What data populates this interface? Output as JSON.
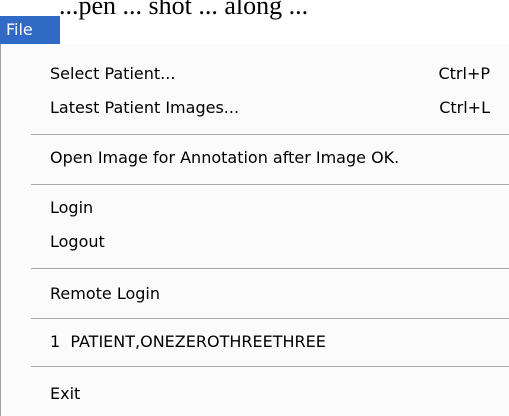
{
  "caption_fragment": "...pen ... shot ... along ...",
  "menubar": {
    "title": "File"
  },
  "menu": {
    "items": [
      {
        "label": "Select Patient...",
        "shortcut": "Ctrl+P"
      },
      {
        "label": "Latest Patient Images...",
        "shortcut": "Ctrl+L"
      },
      {
        "label": "Open Image for Annotation after Image OK."
      },
      {
        "label": "Login"
      },
      {
        "label": "Logout"
      },
      {
        "label": "Remote Login"
      },
      {
        "label": "1  PATIENT,ONEZEROTHREETHREE"
      },
      {
        "label": "Exit"
      }
    ]
  },
  "colors": {
    "highlight": "#316ac5",
    "menu_background": "#fbfbfb",
    "separator": "#a8a8a8"
  }
}
